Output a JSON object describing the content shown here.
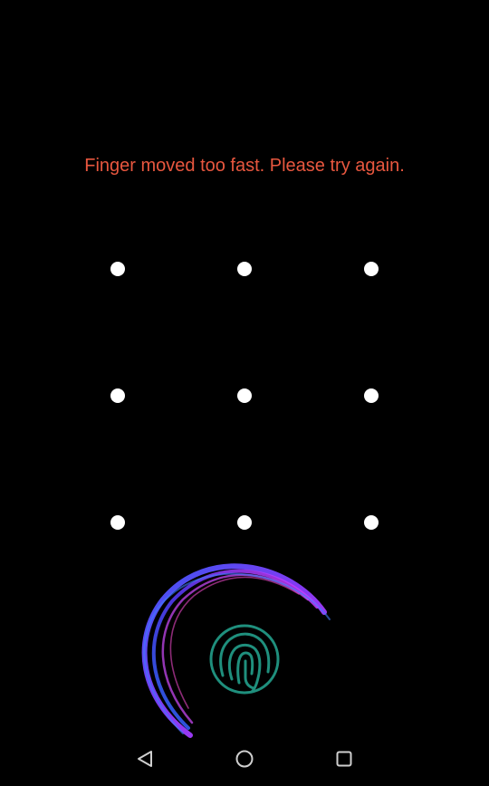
{
  "lockscreen": {
    "error_message": "Finger moved too fast. Please try again."
  },
  "pattern": {
    "dot_count": 9,
    "rows": 3,
    "cols": 3
  },
  "fingerprint": {
    "icon": "fingerprint-icon",
    "ring_colors": [
      "#3d5bff",
      "#8a3cff",
      "#e23cff"
    ],
    "icon_color": "#1f8f7d"
  },
  "nav": {
    "back_icon": "back-triangle-icon",
    "home_icon": "home-circle-icon",
    "recents_icon": "recents-square-icon"
  }
}
